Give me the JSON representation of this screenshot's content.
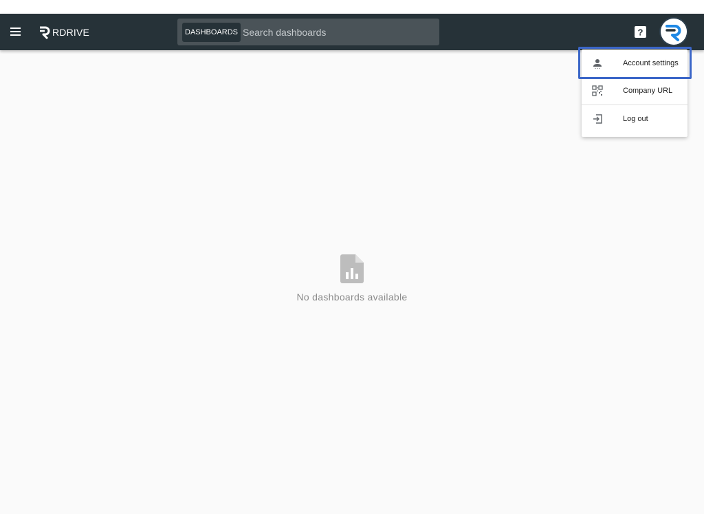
{
  "brand": {
    "name": "RDRIVE"
  },
  "topbar": {
    "menu_icon": "hamburger-icon",
    "search": {
      "scope_label": "DASHBOARDS",
      "placeholder": "Search dashboards",
      "value": ""
    },
    "help_icon": "help-icon",
    "avatar_icon": "rdrive-avatar"
  },
  "account_menu": {
    "items": [
      {
        "label": "Account settings",
        "icon": "person-icon"
      },
      {
        "label": "Company URL",
        "icon": "qr-code-icon"
      },
      {
        "label": "Log out",
        "icon": "logout-icon"
      }
    ]
  },
  "empty_state": {
    "icon": "chart-file-icon",
    "message": "No dashboards available"
  },
  "colors": {
    "topbar": "#263238",
    "background": "#fafafa",
    "highlight": "#3b66c8",
    "empty_text": "#8a8a8a"
  }
}
